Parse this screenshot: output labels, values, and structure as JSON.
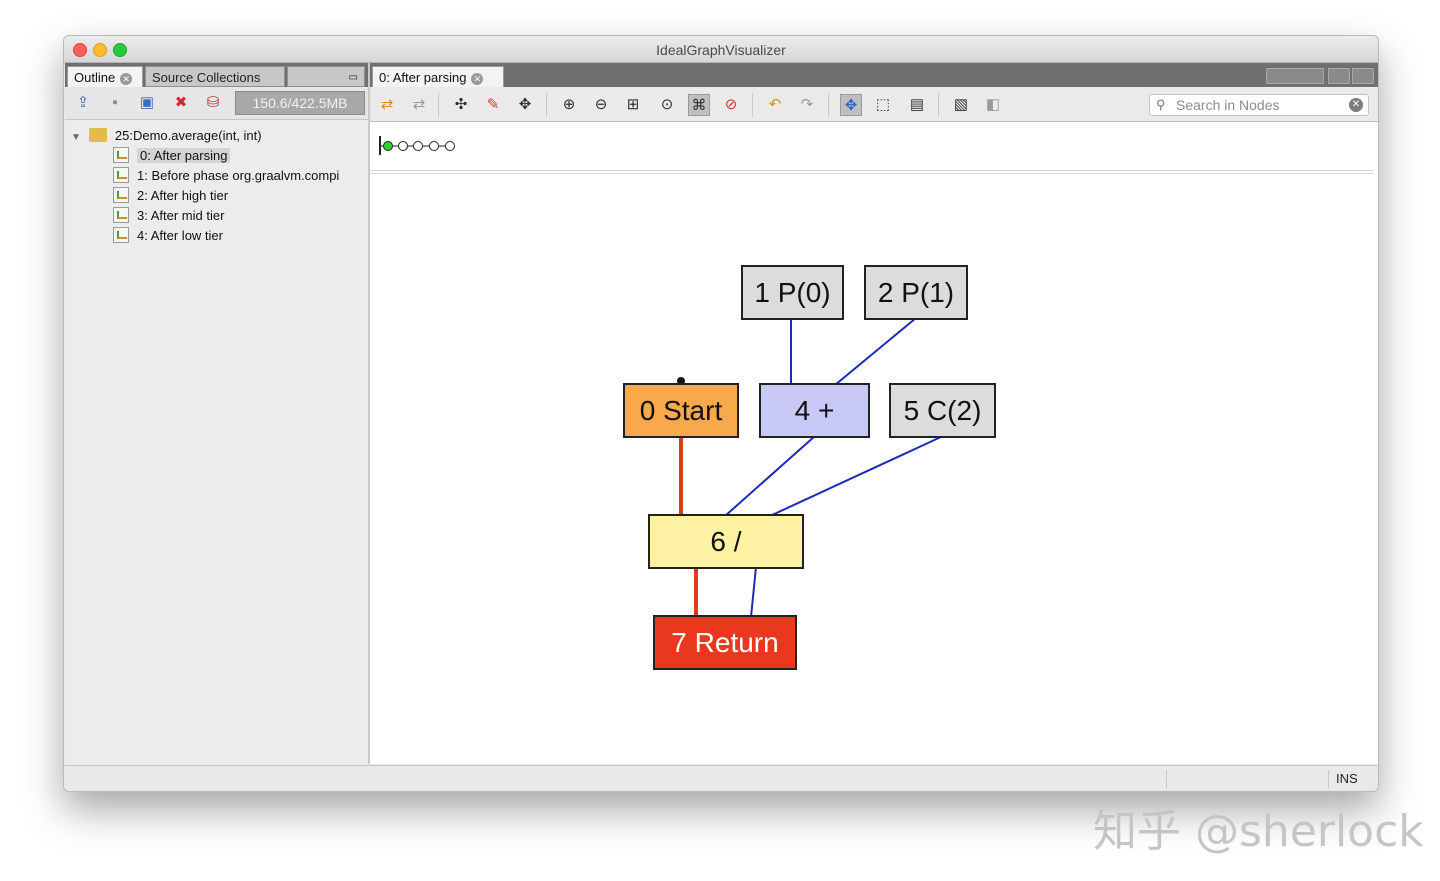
{
  "window": {
    "title": "IdealGraphVisualizer"
  },
  "left_panel": {
    "tabs": [
      "Outline",
      "Source Collections"
    ],
    "memory": "150.6/422.5MB",
    "tree": {
      "root": "25:Demo.average(int, int)",
      "items": [
        "0: After parsing",
        "1: Before phase org.graalvm.compi",
        "2: After high tier",
        "3: After mid tier",
        "4: After low tier"
      ]
    }
  },
  "editor": {
    "tab_label": "0: After parsing",
    "search": {
      "placeholder": "Search in Nodes"
    },
    "toolbar_icons": [
      "prev-snapshot-icon",
      "next-snapshot-icon",
      "expand-icon",
      "hide-icon",
      "show-all-icon",
      "zoom-in-icon",
      "zoom-out-icon",
      "fit-icon",
      "zoom-selection-icon",
      "layout-icon",
      "no-sync-icon",
      "undo-icon",
      "redo-icon",
      "pan-icon",
      "select-icon",
      "overview-icon",
      "export-icon",
      "settings-icon"
    ]
  },
  "graph": {
    "nodes": [
      {
        "id": "1 P(0)",
        "color": "#dcdcdc"
      },
      {
        "id": "2 P(1)",
        "color": "#dcdcdc"
      },
      {
        "id": "0 Start",
        "color": "#f7a94b"
      },
      {
        "id": "4 +",
        "color": "#c9c9f7"
      },
      {
        "id": "5 C(2)",
        "color": "#dcdcdc"
      },
      {
        "id": "6 /",
        "color": "#fdf1a4"
      },
      {
        "id": "7 Return",
        "color": "#e9381e"
      }
    ],
    "edge_colors": {
      "control": "#e03c24",
      "data": "#1a2bb8"
    }
  },
  "status": {
    "mode": "INS"
  },
  "watermark": "知乎 @sherlock"
}
